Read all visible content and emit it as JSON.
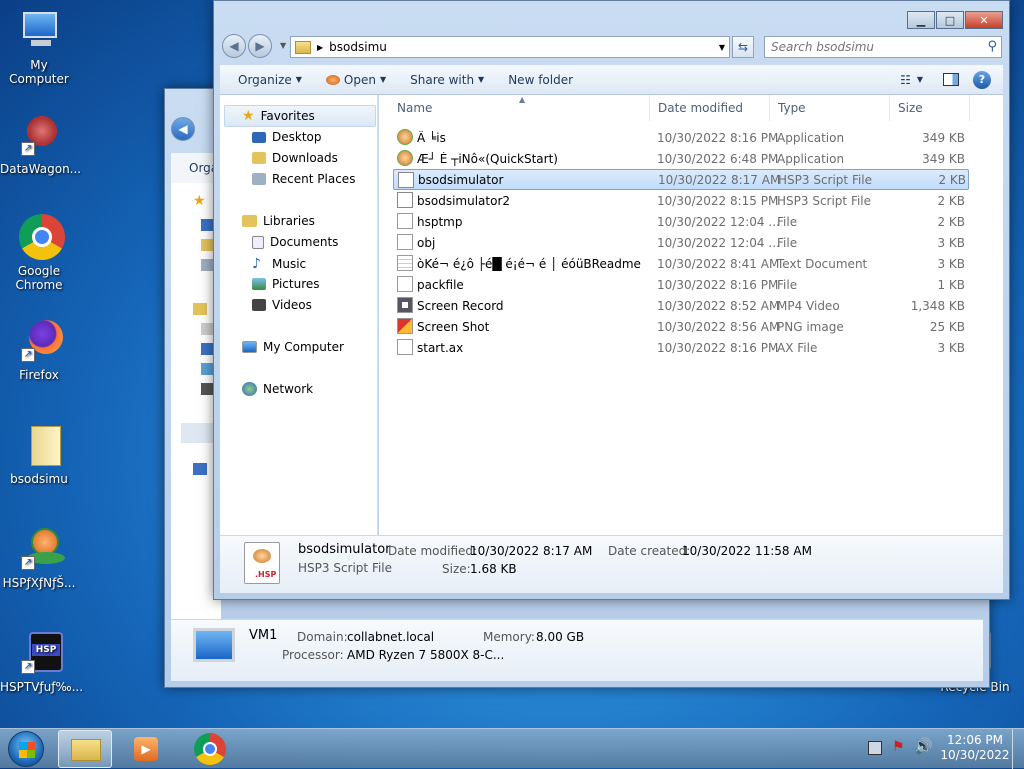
{
  "desktop_icons": [
    {
      "label": "My Computer",
      "icon": "computer-icon"
    },
    {
      "label": "DataWagon...",
      "icon": "datawagon-icon"
    },
    {
      "label": "Google Chrome",
      "icon": "chrome-icon"
    },
    {
      "label": "Firefox",
      "icon": "firefox-icon"
    },
    {
      "label": "bsodsimu",
      "icon": "folder-icon"
    },
    {
      "label": "HSPƒXƒNƒŠ...",
      "icon": "hsp-icon"
    },
    {
      "label": "HSPTVƒuƒ‰...",
      "icon": "hsptv-icon"
    },
    {
      "label": "Recycle Bin",
      "icon": "recycle-bin-icon"
    }
  ],
  "back_window": {
    "toolbar_fragment": "Orga",
    "details": {
      "name": "VM1",
      "domain_label": "Domain:",
      "domain": "collabnet.local",
      "memory_label": "Memory:",
      "memory": "8.00 GB",
      "processor_label": "Processor:",
      "processor": "AMD Ryzen 7 5800X 8-C..."
    }
  },
  "explorer": {
    "breadcrumb": "bsodsimu",
    "search_placeholder": "Search bsodsimu",
    "toolbar": {
      "organize": "Organize",
      "open": "Open",
      "share_with": "Share with",
      "new_folder": "New folder"
    },
    "nav": {
      "favorites": "Favorites",
      "desktop": "Desktop",
      "downloads": "Downloads",
      "recent_places": "Recent Places",
      "libraries": "Libraries",
      "documents": "Documents",
      "music": "Music",
      "pictures": "Pictures",
      "videos": "Videos",
      "my_computer": "My Computer",
      "network": "Network"
    },
    "columns": {
      "name": "Name",
      "date_modified": "Date modified",
      "type": "Type",
      "size": "Size"
    },
    "files": [
      {
        "name": "Ä ╘is",
        "date": "10/30/2022 8:16 PM",
        "type": "Application",
        "size": "349 KB",
        "icon": "application-icon"
      },
      {
        "name": "Æ┘ É ┬iNô«(QuickStart)",
        "date": "10/30/2022 6:48 PM",
        "type": "Application",
        "size": "349 KB",
        "icon": "application-icon"
      },
      {
        "name": "bsodsimulator",
        "date": "10/30/2022 8:17 AM",
        "type": "HSP3 Script File",
        "size": "2 KB",
        "icon": "hsp-script-icon"
      },
      {
        "name": "bsodsimulator2",
        "date": "10/30/2022 8:15 PM",
        "type": "HSP3 Script File",
        "size": "2 KB",
        "icon": "hsp-script-icon"
      },
      {
        "name": "hsptmp",
        "date": "10/30/2022 12:04 ...",
        "type": "File",
        "size": "2 KB",
        "icon": "file-icon"
      },
      {
        "name": "obj",
        "date": "10/30/2022 12:04 ...",
        "type": "File",
        "size": "3 KB",
        "icon": "file-icon"
      },
      {
        "name": "òKé¬ é¿ô ├é█ é¡é¬ é │ éóüBReadme",
        "date": "10/30/2022 8:41 AM",
        "type": "Text Document",
        "size": "3 KB",
        "icon": "text-file-icon"
      },
      {
        "name": "packfile",
        "date": "10/30/2022 8:16 PM",
        "type": "File",
        "size": "1 KB",
        "icon": "file-icon"
      },
      {
        "name": "Screen Record",
        "date": "10/30/2022 8:52 AM",
        "type": "MP4 Video",
        "size": "1,348 KB",
        "icon": "video-file-icon"
      },
      {
        "name": "Screen Shot",
        "date": "10/30/2022 8:56 AM",
        "type": "PNG image",
        "size": "25 KB",
        "icon": "image-file-icon"
      },
      {
        "name": "start.ax",
        "date": "10/30/2022 8:16 PM",
        "type": "AX File",
        "size": "3 KB",
        "icon": "file-icon"
      }
    ],
    "details": {
      "name": "bsodsimulator",
      "type": "HSP3 Script File",
      "date_modified_label": "Date modified:",
      "date_modified": "10/30/2022 8:17 AM",
      "date_created_label": "Date created:",
      "date_created": "10/30/2022 11:58 AM",
      "size_label": "Size:",
      "size": "1.68 KB"
    }
  },
  "taskbar": {
    "time": "12:06 PM",
    "date": "10/30/2022"
  }
}
